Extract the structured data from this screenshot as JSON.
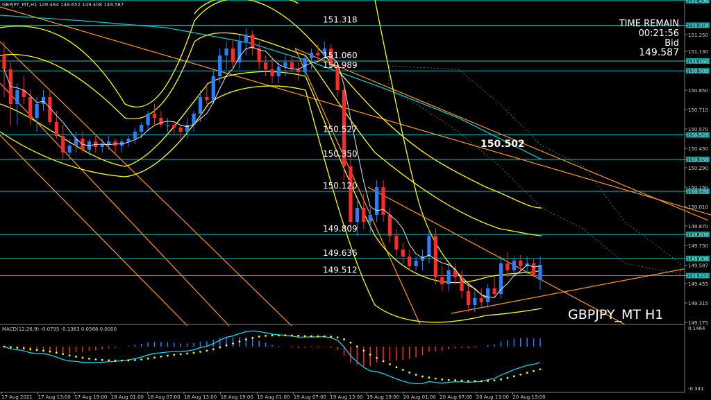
{
  "header": {
    "symbol_info": "GBPJPY_MT,H1  149.484 149.652 149.408 149.587"
  },
  "info": {
    "time_remain_label": "TIME REMAIN",
    "time_remain_value": "00:21:56",
    "bid_label": "Bid",
    "bid_value": "149.587"
  },
  "watermark": "GBPJPY_MT H1",
  "ma_label": "150.502",
  "macd_label": "MACD(12,26,9) -0.0795 -0.1363 0.0568 0.0000",
  "colors": {
    "up": "#2a7fff",
    "down": "#ff2a2a",
    "level": "#00c8c8",
    "band": "#ffff00",
    "channel": "#ff9a1a",
    "macd_hist_pos": "#2a7fff",
    "macd_hist_neg": "#ff2a2a",
    "macd_signal": "#ffff00",
    "macd_line": "#00e5ff"
  },
  "chart_data": {
    "type": "candlestick",
    "symbol": "GBPJPY_MT",
    "timeframe": "H1",
    "ylim": [
      149.17,
      151.5
    ],
    "price_ticks": [
      "151.496",
      "151.318",
      "151.250",
      "151.130",
      "151.060",
      "150.989",
      "150.850",
      "150.710",
      "150.570",
      "150.527",
      "150.430",
      "150.350",
      "150.290",
      "150.150",
      "150.120",
      "150.010",
      "149.870",
      "149.809",
      "149.730",
      "149.636",
      "149.587",
      "149.512",
      "149.455",
      "149.315",
      "149.175"
    ],
    "x_ticks": [
      "17 Aug 2021",
      "17 Aug 13:00",
      "17 Aug 19:00",
      "18 Aug 01:00",
      "18 Aug 07:00",
      "18 Aug 13:00",
      "18 Aug 19:00",
      "19 Aug 01:00",
      "19 Aug 07:00",
      "19 Aug 13:00",
      "19 Aug 19:00",
      "20 Aug 01:00",
      "20 Aug 07:00",
      "20 Aug 13:00",
      "20 Aug 19:00"
    ],
    "levels": [
      151.496,
      151.318,
      151.06,
      150.989,
      150.527,
      150.35,
      150.12,
      149.809,
      149.636,
      149.512
    ],
    "level_labels": [
      "151.496",
      "151.318",
      "151.060",
      "150.989",
      "150.527",
      "150.350",
      "150.120",
      "149.809",
      "149.636",
      "149.512"
    ],
    "level_value_labels": [
      "151.318",
      "151.060",
      "150.989",
      "150.527",
      "150.350",
      "150.120",
      "149.809",
      "149.636",
      "149.512"
    ],
    "candles": [
      [
        151.1,
        151.2,
        150.8,
        151.0
      ],
      [
        151.0,
        151.05,
        150.6,
        150.75
      ],
      [
        150.75,
        150.9,
        150.6,
        150.85
      ],
      [
        150.85,
        150.95,
        150.75,
        150.8
      ],
      [
        150.8,
        150.85,
        150.6,
        150.65
      ],
      [
        150.65,
        150.8,
        150.55,
        150.75
      ],
      [
        150.75,
        150.85,
        150.7,
        150.8
      ],
      [
        150.8,
        150.85,
        150.6,
        150.62
      ],
      [
        150.62,
        150.7,
        150.5,
        150.52
      ],
      [
        150.52,
        150.6,
        150.35,
        150.4
      ],
      [
        150.4,
        150.5,
        150.35,
        150.45
      ],
      [
        150.45,
        150.55,
        150.4,
        150.5
      ],
      [
        150.5,
        150.55,
        150.4,
        150.42
      ],
      [
        150.42,
        150.5,
        150.38,
        150.48
      ],
      [
        150.48,
        150.52,
        150.4,
        150.44
      ],
      [
        150.44,
        150.5,
        150.4,
        150.46
      ],
      [
        150.46,
        150.52,
        150.42,
        150.48
      ],
      [
        150.48,
        150.5,
        150.38,
        150.45
      ],
      [
        150.45,
        150.5,
        150.4,
        150.48
      ],
      [
        150.48,
        150.52,
        150.44,
        150.5
      ],
      [
        150.5,
        150.58,
        150.46,
        150.55
      ],
      [
        150.55,
        150.62,
        150.5,
        150.6
      ],
      [
        150.6,
        150.7,
        150.55,
        150.68
      ],
      [
        150.68,
        150.75,
        150.6,
        150.65
      ],
      [
        150.65,
        150.7,
        150.58,
        150.6
      ],
      [
        150.6,
        150.65,
        150.55,
        150.6
      ],
      [
        150.6,
        150.62,
        150.52,
        150.58
      ],
      [
        150.58,
        150.6,
        150.5,
        150.55
      ],
      [
        150.55,
        150.65,
        150.5,
        150.6
      ],
      [
        150.6,
        150.7,
        150.55,
        150.68
      ],
      [
        150.68,
        150.85,
        150.62,
        150.8
      ],
      [
        150.8,
        150.9,
        150.75,
        150.78
      ],
      [
        150.78,
        151.0,
        150.75,
        150.95
      ],
      [
        150.95,
        151.15,
        150.9,
        151.1
      ],
      [
        151.1,
        151.2,
        151.0,
        151.15
      ],
      [
        151.15,
        151.22,
        151.0,
        151.05
      ],
      [
        151.05,
        151.25,
        151.0,
        151.2
      ],
      [
        151.2,
        151.3,
        151.1,
        151.25
      ],
      [
        151.25,
        151.28,
        151.1,
        151.15
      ],
      [
        151.15,
        151.2,
        151.0,
        151.05
      ],
      [
        151.05,
        151.1,
        150.95,
        151.0
      ],
      [
        151.0,
        151.08,
        150.9,
        150.95
      ],
      [
        150.95,
        151.05,
        150.9,
        151.02
      ],
      [
        151.02,
        151.1,
        150.95,
        151.05
      ],
      [
        151.05,
        151.1,
        150.98,
        151.0
      ],
      [
        151.0,
        151.05,
        150.92,
        150.98
      ],
      [
        150.98,
        151.1,
        150.95,
        151.08
      ],
      [
        151.08,
        151.15,
        151.0,
        151.12
      ],
      [
        151.12,
        151.18,
        151.05,
        151.1
      ],
      [
        151.1,
        151.2,
        151.05,
        151.15
      ],
      [
        151.15,
        151.18,
        151.0,
        151.02
      ],
      [
        151.02,
        151.05,
        150.8,
        150.85
      ],
      [
        150.85,
        150.9,
        150.2,
        150.3
      ],
      [
        150.3,
        150.4,
        149.85,
        149.9
      ],
      [
        149.9,
        150.05,
        149.8,
        150.0
      ],
      [
        150.0,
        150.1,
        149.85,
        149.9
      ],
      [
        149.9,
        150.0,
        149.82,
        149.95
      ],
      [
        149.95,
        150.2,
        149.9,
        150.15
      ],
      [
        150.15,
        150.2,
        149.9,
        149.95
      ],
      [
        149.95,
        150.0,
        149.75,
        149.8
      ],
      [
        149.8,
        149.85,
        149.65,
        149.7
      ],
      [
        149.7,
        149.75,
        149.6,
        149.65
      ],
      [
        149.65,
        149.7,
        149.55,
        149.58
      ],
      [
        149.58,
        149.65,
        149.55,
        149.62
      ],
      [
        149.62,
        149.7,
        149.55,
        149.65
      ],
      [
        149.65,
        149.85,
        149.6,
        149.8
      ],
      [
        149.8,
        149.85,
        149.45,
        149.5
      ],
      [
        149.5,
        149.58,
        149.4,
        149.45
      ],
      [
        149.45,
        149.6,
        149.4,
        149.55
      ],
      [
        149.55,
        149.6,
        149.45,
        149.5
      ],
      [
        149.5,
        149.55,
        149.35,
        149.4
      ],
      [
        149.4,
        149.45,
        149.25,
        149.3
      ],
      [
        149.3,
        149.4,
        149.25,
        149.35
      ],
      [
        149.35,
        149.42,
        149.28,
        149.32
      ],
      [
        149.32,
        149.45,
        149.28,
        149.42
      ],
      [
        149.42,
        149.5,
        149.35,
        149.38
      ],
      [
        149.38,
        149.65,
        149.35,
        149.6
      ],
      [
        149.6,
        149.68,
        149.5,
        149.55
      ],
      [
        149.55,
        149.65,
        149.5,
        149.62
      ],
      [
        149.62,
        149.66,
        149.55,
        149.58
      ],
      [
        149.58,
        149.65,
        149.52,
        149.6
      ],
      [
        149.6,
        149.63,
        149.5,
        149.52
      ],
      [
        149.48,
        149.65,
        149.41,
        149.59
      ]
    ],
    "macd": {
      "name": "MACD(12,26,9)",
      "values": [
        -0.0795,
        -0.1363,
        0.0568,
        0.0
      ],
      "top_tick": "0.1464",
      "bottom_tick": "-0.341"
    }
  }
}
